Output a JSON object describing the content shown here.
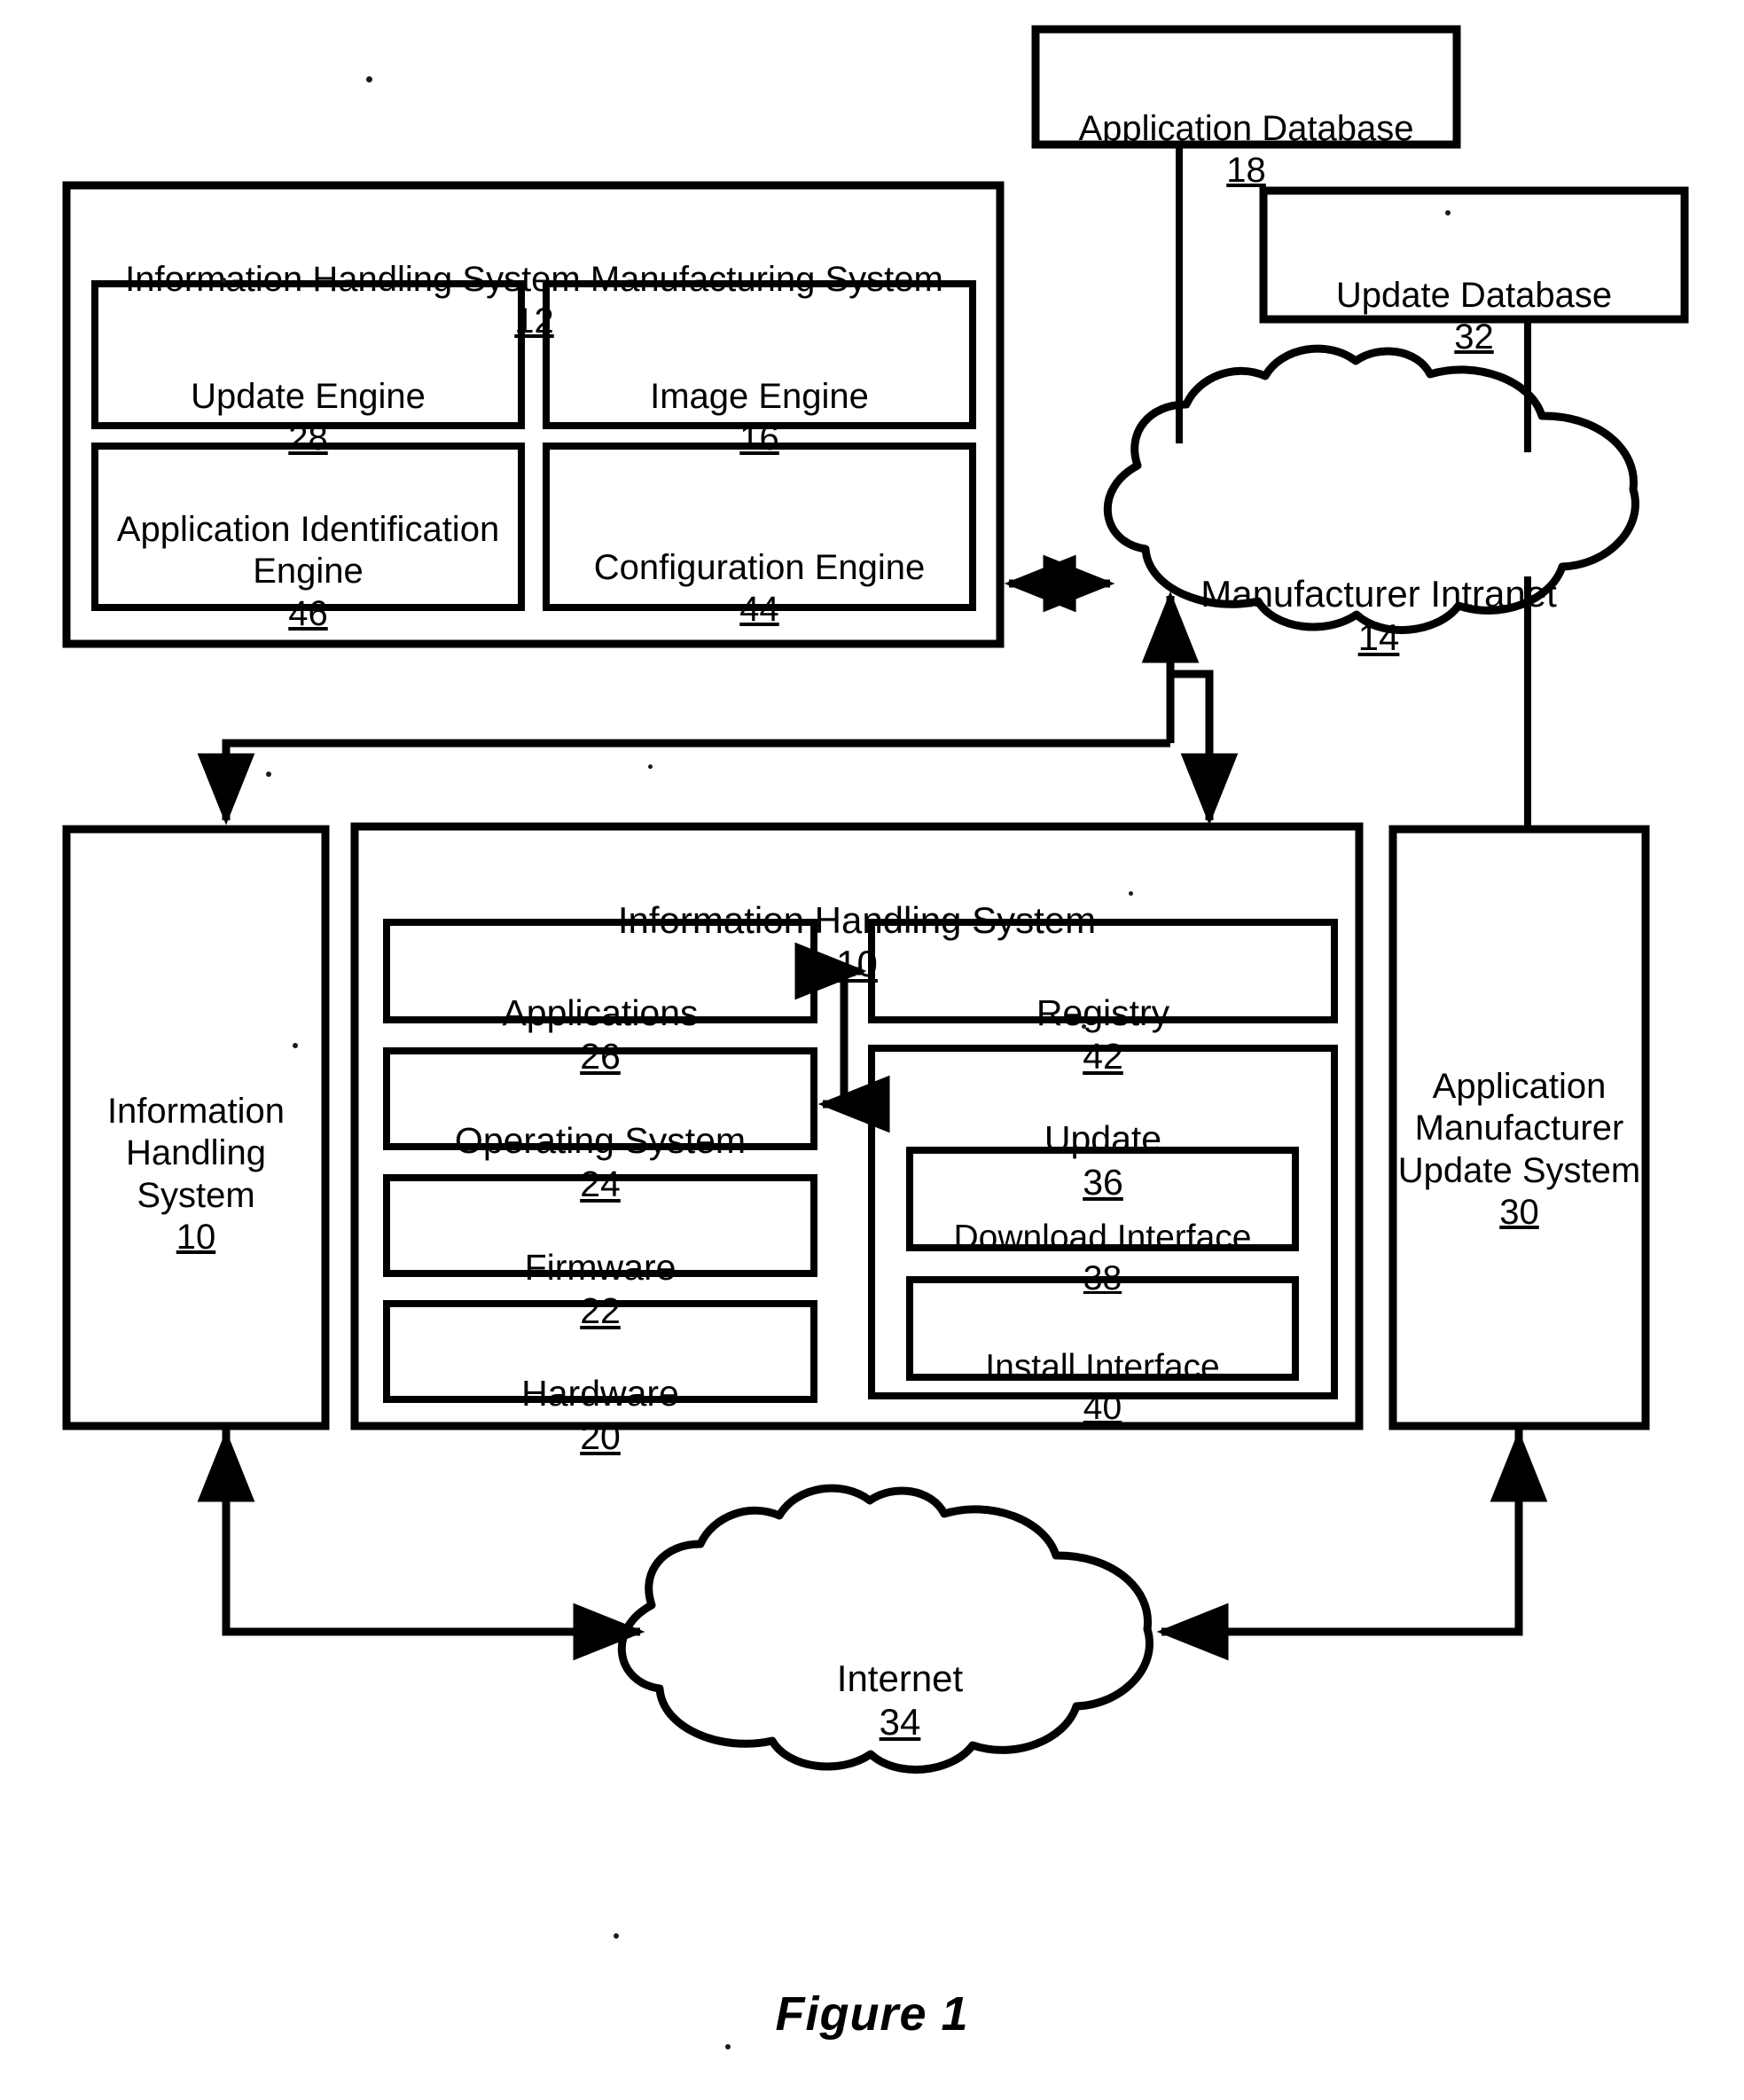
{
  "figure": {
    "caption": "Figure 1"
  },
  "blocks": {
    "manufacturing_system": {
      "title": "Information Handling System Manufacturing System",
      "ref": "12"
    },
    "update_engine": {
      "title": "Update Engine",
      "ref": "28"
    },
    "image_engine": {
      "title": "Image Engine",
      "ref": "16"
    },
    "app_identification_engine": {
      "title": "Application Identification Engine",
      "ref": "46"
    },
    "configuration_engine": {
      "title": "Configuration Engine",
      "ref": "44"
    },
    "application_database": {
      "title": "Application Database",
      "ref": "18"
    },
    "update_database": {
      "title": "Update Database",
      "ref": "32"
    },
    "manufacturer_intranet": {
      "title": "Manufacturer Intranet",
      "ref": "14"
    },
    "information_handling_system_left": {
      "title": "Information Handling System",
      "ref": "10"
    },
    "information_handling_system_main": {
      "title": "Information Handling System",
      "ref": "10"
    },
    "applications": {
      "title": "Applications",
      "ref": "26"
    },
    "registry": {
      "title": "Registry",
      "ref": "42"
    },
    "operating_system": {
      "title": "Operating System",
      "ref": "24"
    },
    "update": {
      "title": "Update",
      "ref": "36"
    },
    "download_interface": {
      "title": "Download Interface",
      "ref": "38"
    },
    "install_interface": {
      "title": "Install Interface",
      "ref": "40"
    },
    "firmware": {
      "title": "Firmware",
      "ref": "22"
    },
    "hardware": {
      "title": "Hardware",
      "ref": "20"
    },
    "app_manufacturer_update_system": {
      "title": "Application Manufacturer Update System",
      "ref": "30"
    },
    "internet": {
      "title": "Internet",
      "ref": "34"
    }
  },
  "connections": [
    {
      "name": "application-database-to-intranet",
      "from": "application_database",
      "to": "manufacturer_intranet",
      "direction": "one-way"
    },
    {
      "name": "update-database-to-intranet",
      "from": "update_database",
      "to": "manufacturer_intranet",
      "direction": "one-way"
    },
    {
      "name": "manufacturing-system-to-intranet",
      "from": "manufacturing_system",
      "to": "manufacturer_intranet",
      "direction": "bidirectional"
    },
    {
      "name": "intranet-to-information-handling-system-left",
      "from": "manufacturer_intranet",
      "to": "information_handling_system_left",
      "direction": "one-way"
    },
    {
      "name": "intranet-to-information-handling-system-main",
      "from": "manufacturer_intranet",
      "to": "information_handling_system_main",
      "direction": "one-way"
    },
    {
      "name": "applications-to-registry",
      "from": "applications",
      "to": "registry",
      "direction": "one-way"
    },
    {
      "name": "registry-to-operating-system",
      "from": "registry",
      "to": "operating_system",
      "direction": "one-way"
    },
    {
      "name": "information-handling-system-left-to-internet",
      "from": "information_handling_system_left",
      "to": "internet",
      "direction": "bidirectional"
    },
    {
      "name": "app-manufacturer-update-system-to-internet",
      "from": "app_manufacturer_update_system",
      "to": "internet",
      "direction": "bidirectional"
    }
  ],
  "colors": {
    "ink": "#000000",
    "paper": "#ffffff"
  }
}
